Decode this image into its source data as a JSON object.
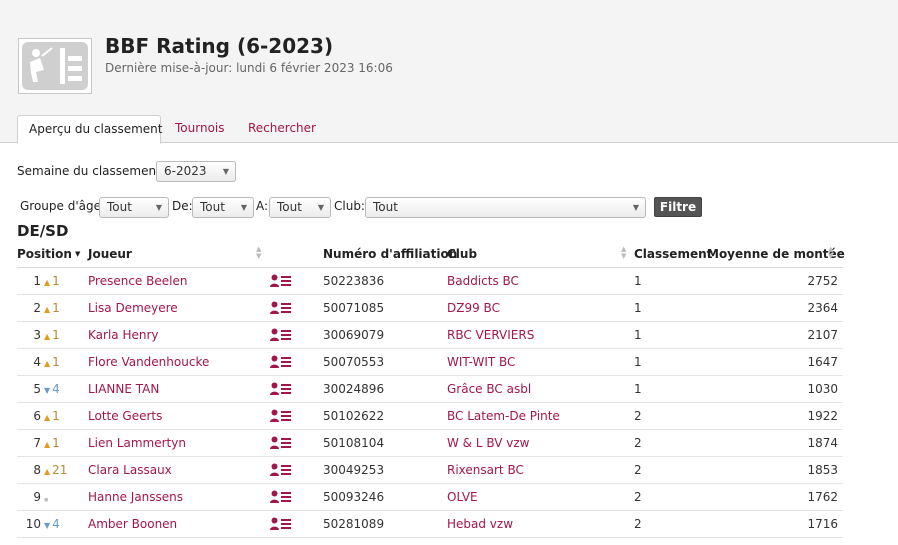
{
  "header": {
    "title": "BBF Rating (6-2023)",
    "subtitle": "Dernière mise-à-jour: lundi 6 février 2023 16:06"
  },
  "tabs": [
    {
      "label": "Aperçu du classement",
      "active": true
    },
    {
      "label": "Tournois",
      "active": false
    },
    {
      "label": "Rechercher",
      "active": false
    }
  ],
  "filters": {
    "week_label": "Semaine du classement:",
    "week_value": "6-2023",
    "age_label": "Groupe d'âge :",
    "age_value": "Tout",
    "from_label": "De:",
    "from_value": "Tout",
    "to_label": "A:",
    "to_value": "Tout",
    "club_label": "Club:",
    "club_value": "Tout",
    "filter_button": "Filtre"
  },
  "section_title": "DE/SD",
  "table": {
    "columns": {
      "position": "Position",
      "player": "Joueur",
      "affiliation": "Numéro d'affiliation",
      "club": "Club",
      "rank": "Classement",
      "average": "Moyenne de montée"
    },
    "rows": [
      {
        "position": "1",
        "change": "1",
        "direction": "up",
        "player": "Presence Beelen",
        "affiliation": "50223836",
        "club": "Baddicts BC",
        "rank": "1",
        "average": "2752"
      },
      {
        "position": "2",
        "change": "1",
        "direction": "up",
        "player": "Lisa Demeyere",
        "affiliation": "50071085",
        "club": "DZ99 BC",
        "rank": "1",
        "average": "2364"
      },
      {
        "position": "3",
        "change": "1",
        "direction": "up",
        "player": "Karla Henry",
        "affiliation": "30069079",
        "club": "RBC VERVIERS",
        "rank": "1",
        "average": "2107"
      },
      {
        "position": "4",
        "change": "1",
        "direction": "up",
        "player": "Flore Vandenhoucke",
        "affiliation": "50070553",
        "club": "WIT-WIT BC",
        "rank": "1",
        "average": "1647"
      },
      {
        "position": "5",
        "change": "4",
        "direction": "down",
        "player": "LIANNE TAN",
        "affiliation": "30024896",
        "club": "Grâce BC asbl",
        "rank": "1",
        "average": "1030"
      },
      {
        "position": "6",
        "change": "1",
        "direction": "up",
        "player": "Lotte Geerts",
        "affiliation": "50102622",
        "club": "BC Latem-De Pinte",
        "rank": "2",
        "average": "1922"
      },
      {
        "position": "7",
        "change": "1",
        "direction": "up",
        "player": "Lien Lammertyn",
        "affiliation": "50108104",
        "club": "W & L BV vzw",
        "rank": "2",
        "average": "1874"
      },
      {
        "position": "8",
        "change": "21",
        "direction": "up",
        "player": "Clara Lassaux",
        "affiliation": "30049253",
        "club": "Rixensart BC",
        "rank": "2",
        "average": "1853"
      },
      {
        "position": "9",
        "change": "",
        "direction": "same",
        "player": "Hanne Janssens",
        "affiliation": "50093246",
        "club": "OLVE",
        "rank": "2",
        "average": "1762"
      },
      {
        "position": "10",
        "change": "4",
        "direction": "down",
        "player": "Amber Boonen",
        "affiliation": "50281089",
        "club": "Hebad vzw",
        "rank": "2",
        "average": "1716"
      }
    ]
  },
  "icons": {
    "logo": "bbf-logo-icon",
    "profile": "player-profile-icon"
  },
  "colors": {
    "link": "#a3164a",
    "up": "#e59a1e",
    "down": "#6a9bc7"
  }
}
